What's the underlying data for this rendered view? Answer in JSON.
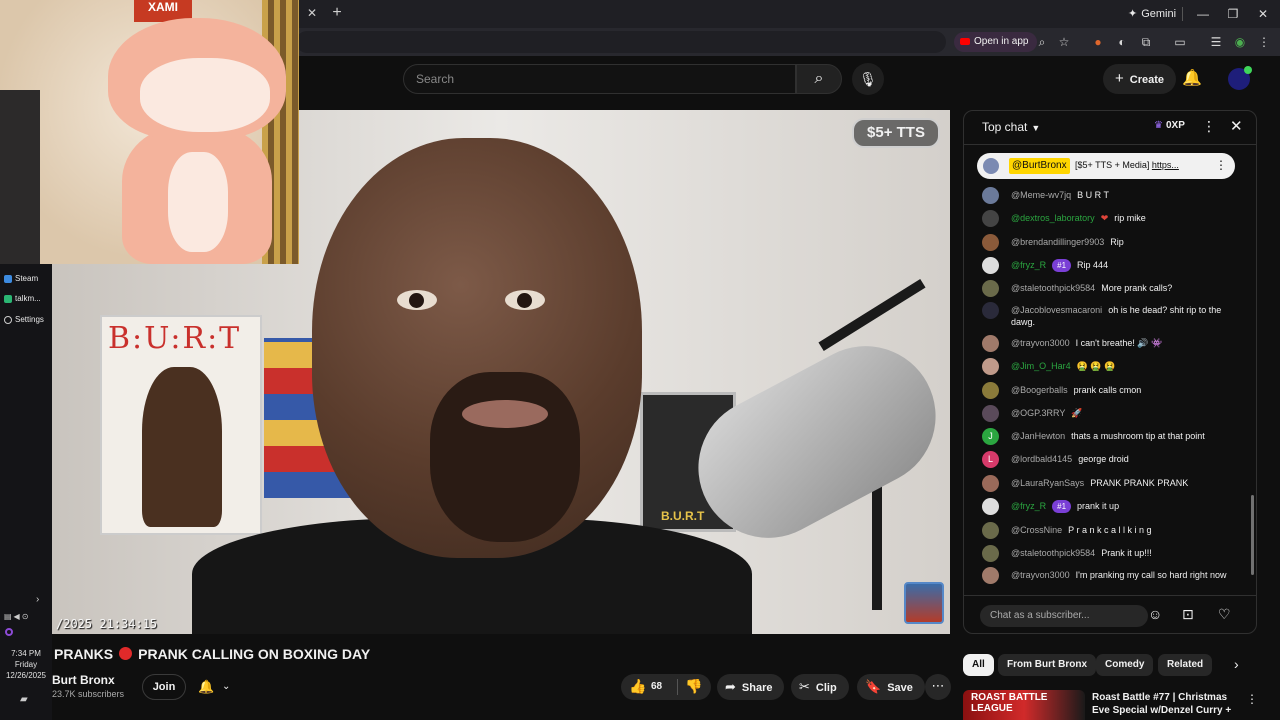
{
  "browser": {
    "gemini_label": "Gemini",
    "open_in_app_label": "Open in app"
  },
  "masthead": {
    "search_placeholder": "Search",
    "create_label": "Create"
  },
  "desktop": {
    "items": [
      {
        "label": "Steam"
      },
      {
        "label": "talkm..."
      },
      {
        "label": "Settings"
      }
    ],
    "clock_time": "7:34 PM",
    "clock_day": "Friday",
    "clock_date": "12/26/2025"
  },
  "video": {
    "badge": "$5+ TTS",
    "stamp": "/2025 21:34:15",
    "poster_title": "B:U:R:T",
    "poster2_title": "B.U.R.T"
  },
  "webcam": {
    "sign": "XAMI"
  },
  "info": {
    "title_left": "PRANKS",
    "title_right": "PRANK CALLING ON BOXING DAY",
    "channel": "Burt Bronx",
    "subscribers": "23.7K subscribers",
    "join_label": "Join",
    "like_count": "68",
    "share_label": "Share",
    "clip_label": "Clip",
    "save_label": "Save"
  },
  "chat": {
    "header": "Top chat",
    "xp": "0XP",
    "pinned": {
      "user": "@BurtBronx",
      "text": "[$5+ TTS + Media]",
      "link": "https..."
    },
    "messages": [
      {
        "user": "@Meme-wv7jq",
        "text": "B U R T",
        "green": false,
        "avatar_color": "#6b7a9a",
        "avatar_letter": ""
      },
      {
        "user": "@dextros_laboratory",
        "text": "rip mike",
        "green": true,
        "avatar_color": "#444444",
        "avatar_letter": "",
        "badge_emoji": "❤"
      },
      {
        "user": "@brendandillinger9903",
        "text": "Rip",
        "green": false,
        "avatar_color": "#8a5a3a",
        "avatar_letter": ""
      },
      {
        "user": "@fryz_R",
        "text": "Rip 444",
        "green": true,
        "avatar_color": "#dddddd",
        "avatar_letter": "",
        "mod": "#1"
      },
      {
        "user": "@staletoothpick9584",
        "text": "More prank calls?",
        "green": false,
        "avatar_color": "#6a6a4a",
        "avatar_letter": ""
      },
      {
        "user": "@Jacoblovesmacaroni",
        "text": "oh is he dead? shit rip to the dawg.",
        "green": false,
        "avatar_color": "#2a2a3a",
        "avatar_letter": ""
      },
      {
        "user": "@trayvon3000",
        "text": "I can't breathe! 🔊 👾",
        "green": false,
        "avatar_color": "#a07a6a",
        "avatar_letter": ""
      },
      {
        "user": "@Jim_O_Har4",
        "text": "🤮 🤮 🤮",
        "green": true,
        "avatar_color": "#c09a8a",
        "avatar_letter": ""
      },
      {
        "user": "@Boogerballs",
        "text": "prank calls cmon",
        "green": false,
        "avatar_color": "#8a7a3a",
        "avatar_letter": ""
      },
      {
        "user": "@OGP.3RRY",
        "text": "🚀",
        "green": false,
        "avatar_color": "#5a4a5a",
        "avatar_letter": ""
      },
      {
        "user": "@JanHewton",
        "text": "thats a mushroom tip at that point",
        "green": false,
        "avatar_color": "#2ba640",
        "avatar_letter": "J"
      },
      {
        "user": "@lordbald4145",
        "text": "george droid",
        "green": false,
        "avatar_color": "#d63a6a",
        "avatar_letter": "L"
      },
      {
        "user": "@LauraRyanSays",
        "text": "PRANK PRANK PRANK",
        "green": false,
        "avatar_color": "#9a6a5a",
        "avatar_letter": ""
      },
      {
        "user": "@fryz_R",
        "text": "prank it up",
        "green": true,
        "avatar_color": "#dddddd",
        "avatar_letter": "",
        "mod": "#1"
      },
      {
        "user": "@CrossNine",
        "text": "P r a n k c a l l k i n g",
        "green": false,
        "avatar_color": "#6a6a4a",
        "avatar_letter": ""
      },
      {
        "user": "@staletoothpick9584",
        "text": "Prank it up!!!",
        "green": false,
        "avatar_color": "#6a6a4a",
        "avatar_letter": ""
      },
      {
        "user": "@trayvon3000",
        "text": "I'm pranking my call so hard right now",
        "green": false,
        "avatar_color": "#a07a6a",
        "avatar_letter": ""
      }
    ],
    "input_placeholder": "Chat as a subscriber..."
  },
  "related": {
    "filters": [
      "All",
      "From Burt Bronx",
      "Comedy",
      "Related"
    ],
    "thumb_text": "ROAST BATTLE LEAGUE",
    "title": "Roast Battle #77 | Christmas Eve Special w/Denzel Curry + ..."
  },
  "colors": {
    "background": "#0f0f0f",
    "accent_red": "#ff0000",
    "username_green": "#2ba640",
    "highlight_yellow": "#ffd600"
  }
}
